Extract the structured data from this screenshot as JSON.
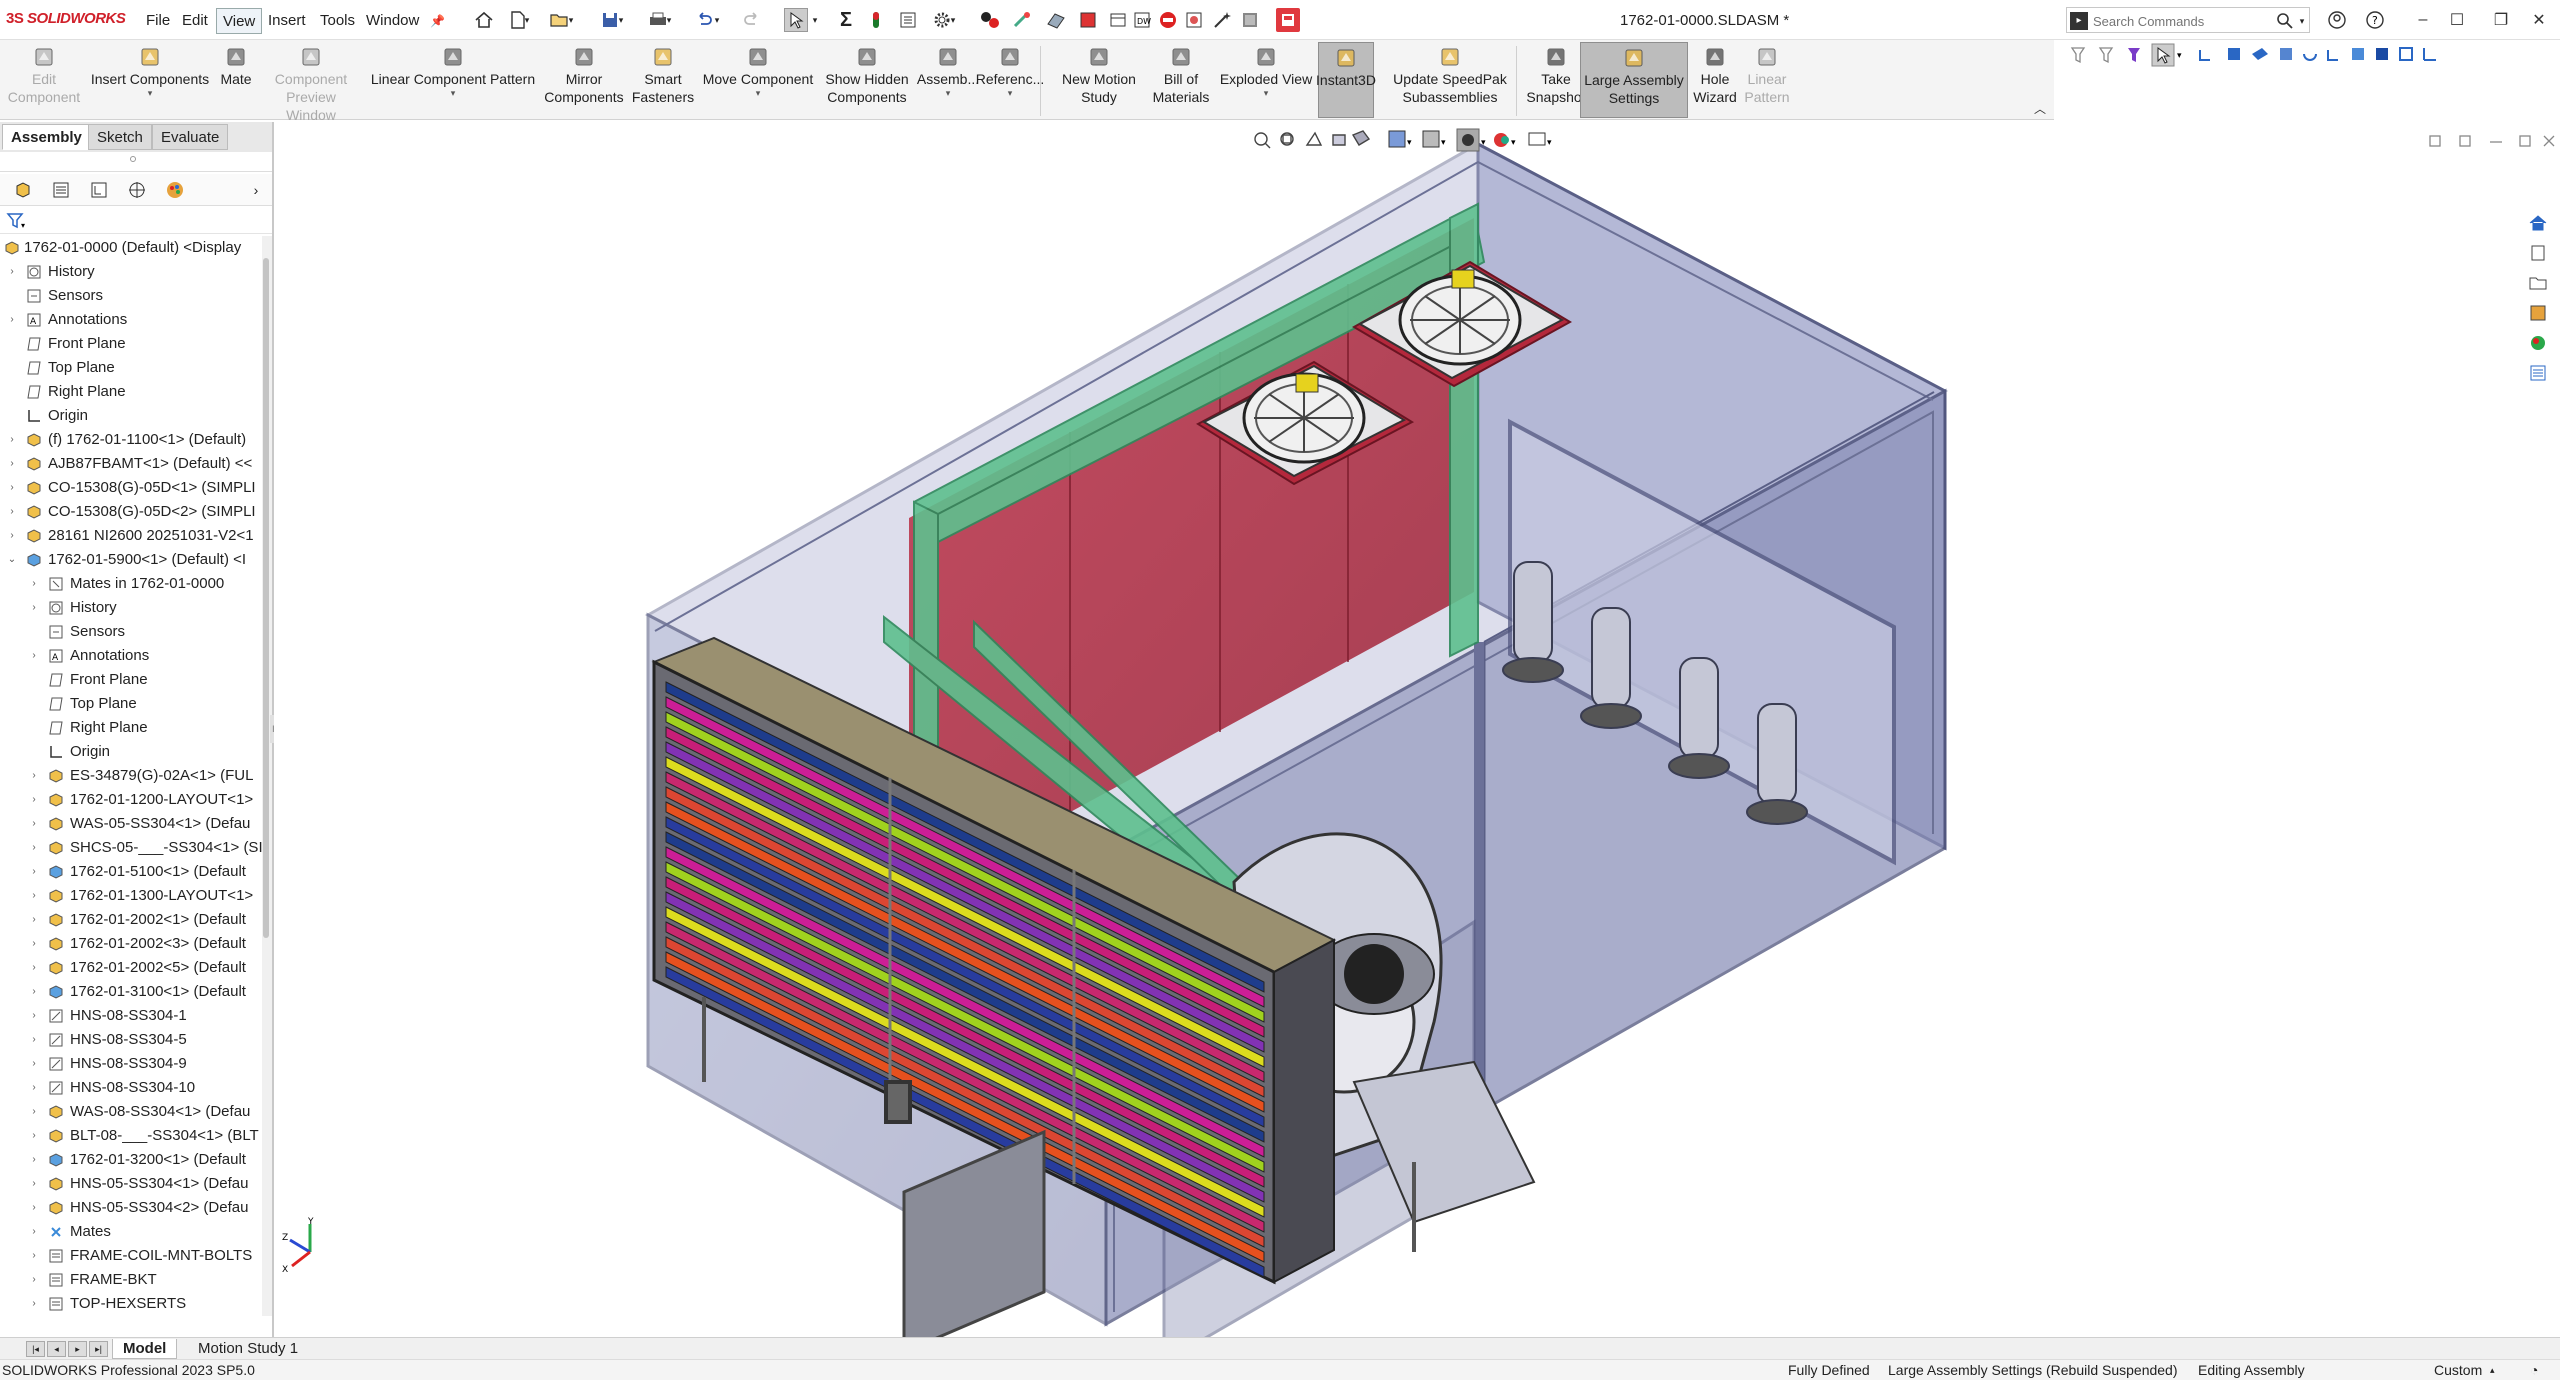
{
  "app": {
    "logo_text": "SOLIDWORKS",
    "logo_mark": "3S",
    "document_title": "1762-01-0000.SLDASM *",
    "accent": "#d0202a"
  },
  "menu": [
    {
      "label": "File"
    },
    {
      "label": "Edit"
    },
    {
      "label": "View",
      "active": true
    },
    {
      "label": "Insert"
    },
    {
      "label": "Tools"
    },
    {
      "label": "Window"
    }
  ],
  "search": {
    "placeholder": "Search Commands"
  },
  "command_manager": [
    {
      "line1": "Edit",
      "line2": "Component",
      "disabled": true,
      "icon": "edit-component-icon"
    },
    {
      "line1": "Insert Components",
      "line2": "",
      "icon": "insert-components-icon",
      "dropdown": true
    },
    {
      "line1": "Mate",
      "line2": "",
      "icon": "mate-icon"
    },
    {
      "line1": "Component",
      "line2": "Preview Window",
      "disabled": true,
      "icon": "component-preview-icon"
    },
    {
      "line1": "Linear Component Pattern",
      "line2": "",
      "icon": "linear-pattern-icon",
      "dropdown": true
    },
    {
      "line1": "Mirror",
      "line2": "Components",
      "icon": "mirror-components-icon"
    },
    {
      "line1": "Smart",
      "line2": "Fasteners",
      "icon": "smart-fasteners-icon"
    },
    {
      "line1": "Move Component",
      "line2": "",
      "icon": "move-component-icon",
      "dropdown": true
    },
    {
      "line1": "Show Hidden",
      "line2": "Components",
      "icon": "show-hidden-icon"
    },
    {
      "line1": "Assemb...",
      "line2": "",
      "icon": "assembly-features-icon",
      "dropdown": true
    },
    {
      "line1": "Referenc...",
      "line2": "",
      "icon": "reference-geometry-icon",
      "dropdown": true
    },
    {
      "line1": "New Motion",
      "line2": "Study",
      "icon": "motion-study-icon"
    },
    {
      "line1": "Bill of",
      "line2": "Materials",
      "icon": "bom-icon"
    },
    {
      "line1": "Exploded View",
      "line2": "",
      "icon": "exploded-view-icon",
      "dropdown": true
    },
    {
      "line1": "Instant3D",
      "line2": "",
      "icon": "instant3d-icon",
      "pressed": true
    },
    {
      "line1": "Update SpeedPak",
      "line2": "Subassemblies",
      "icon": "speedpak-icon"
    },
    {
      "line1": "Take",
      "line2": "Snapshot",
      "icon": "snapshot-icon"
    },
    {
      "line1": "Large Assembly",
      "line2": "Settings",
      "icon": "large-assembly-icon",
      "pressed": true
    },
    {
      "line1": "Hole",
      "line2": "Wizard",
      "icon": "hole-wizard-icon"
    },
    {
      "line1": "Linear",
      "line2": "Pattern",
      "disabled": true,
      "icon": "linear-pattern-feature-icon"
    }
  ],
  "panel_tabs": [
    {
      "label": "Assembly",
      "active": true
    },
    {
      "label": "Sketch"
    },
    {
      "label": "Evaluate"
    }
  ],
  "tree": [
    {
      "label": "1762-01-0000 (Default) <Display",
      "depth": 0,
      "icon": "assembly-icon",
      "exp": ""
    },
    {
      "label": "History",
      "depth": 1,
      "icon": "history-icon",
      "exp": "›"
    },
    {
      "label": "Sensors",
      "depth": 1,
      "icon": "sensors-icon",
      "exp": ""
    },
    {
      "label": "Annotations",
      "depth": 1,
      "icon": "annotations-icon",
      "exp": "›"
    },
    {
      "label": "Front Plane",
      "depth": 1,
      "icon": "plane-icon",
      "exp": ""
    },
    {
      "label": "Top Plane",
      "depth": 1,
      "icon": "plane-icon",
      "exp": ""
    },
    {
      "label": "Right Plane",
      "depth": 1,
      "icon": "plane-icon",
      "exp": ""
    },
    {
      "label": "Origin",
      "depth": 1,
      "icon": "origin-icon",
      "exp": ""
    },
    {
      "label": "(f) 1762-01-1100<1> (Default)",
      "depth": 1,
      "icon": "subassembly-icon",
      "exp": "›"
    },
    {
      "label": "AJB87FBAMT<1> (Default) <<",
      "depth": 1,
      "icon": "subassembly-icon",
      "exp": "›"
    },
    {
      "label": "CO-15308(G)-05D<1> (SIMPLI",
      "depth": 1,
      "icon": "subassembly-icon",
      "exp": "›"
    },
    {
      "label": "CO-15308(G)-05D<2> (SIMPLI",
      "depth": 1,
      "icon": "subassembly-icon",
      "exp": "›"
    },
    {
      "label": "28161 NI2600 20251031-V2<1",
      "depth": 1,
      "icon": "subassembly-icon",
      "exp": "›"
    },
    {
      "label": "1762-01-5900<1> (Default) <I",
      "depth": 1,
      "icon": "subassembly-edit-icon",
      "exp": "⌄"
    },
    {
      "label": "Mates in 1762-01-0000",
      "depth": 2,
      "icon": "mates-folder-icon",
      "exp": "›"
    },
    {
      "label": "History",
      "depth": 2,
      "icon": "history-icon",
      "exp": "›"
    },
    {
      "label": "Sensors",
      "depth": 2,
      "icon": "sensors-icon",
      "exp": ""
    },
    {
      "label": "Annotations",
      "depth": 2,
      "icon": "annotations-icon",
      "exp": "›"
    },
    {
      "label": "Front Plane",
      "depth": 2,
      "icon": "plane-icon",
      "exp": ""
    },
    {
      "label": "Top Plane",
      "depth": 2,
      "icon": "plane-icon",
      "exp": ""
    },
    {
      "label": "Right Plane",
      "depth": 2,
      "icon": "plane-icon",
      "exp": ""
    },
    {
      "label": "Origin",
      "depth": 2,
      "icon": "origin-icon",
      "exp": ""
    },
    {
      "label": "ES-34879(G)-02A<1> (FUL",
      "depth": 2,
      "icon": "subassembly-icon",
      "exp": "›"
    },
    {
      "label": "1762-01-1200-LAYOUT<1>",
      "depth": 2,
      "icon": "subassembly-icon",
      "exp": "›"
    },
    {
      "label": "WAS-05-SS304<1> (Defau",
      "depth": 2,
      "icon": "subassembly-icon",
      "exp": "›"
    },
    {
      "label": "SHCS-05-___-SS304<1> (SI",
      "depth": 2,
      "icon": "subassembly-icon",
      "exp": "›"
    },
    {
      "label": "1762-01-5100<1> (Default",
      "depth": 2,
      "icon": "subassembly-edit-icon",
      "exp": "›"
    },
    {
      "label": "1762-01-1300-LAYOUT<1>",
      "depth": 2,
      "icon": "subassembly-icon",
      "exp": "›"
    },
    {
      "label": "1762-01-2002<1> (Default",
      "depth": 2,
      "icon": "subassembly-icon",
      "exp": "›"
    },
    {
      "label": "1762-01-2002<3> (Default",
      "depth": 2,
      "icon": "subassembly-icon",
      "exp": "›"
    },
    {
      "label": "1762-01-2002<5> (Default",
      "depth": 2,
      "icon": "subassembly-icon",
      "exp": "›"
    },
    {
      "label": "1762-01-3100<1> (Default",
      "depth": 2,
      "icon": "subassembly-edit-icon",
      "exp": "›"
    },
    {
      "label": "HNS-08-SS304-1",
      "depth": 2,
      "icon": "pattern-icon",
      "exp": "›"
    },
    {
      "label": "HNS-08-SS304-5",
      "depth": 2,
      "icon": "pattern-icon",
      "exp": "›"
    },
    {
      "label": "HNS-08-SS304-9",
      "depth": 2,
      "icon": "pattern-icon",
      "exp": "›"
    },
    {
      "label": "HNS-08-SS304-10",
      "depth": 2,
      "icon": "pattern-icon",
      "exp": "›"
    },
    {
      "label": "WAS-08-SS304<1> (Defau",
      "depth": 2,
      "icon": "subassembly-icon",
      "exp": "›"
    },
    {
      "label": "BLT-08-___-SS304<1> (BLT",
      "depth": 2,
      "icon": "subassembly-icon",
      "exp": "›"
    },
    {
      "label": "1762-01-3200<1> (Default",
      "depth": 2,
      "icon": "subassembly-edit-icon",
      "exp": "›"
    },
    {
      "label": "HNS-05-SS304<1> (Defau",
      "depth": 2,
      "icon": "subassembly-icon",
      "exp": "›"
    },
    {
      "label": "HNS-05-SS304<2> (Defau",
      "depth": 2,
      "icon": "subassembly-icon",
      "exp": "›"
    },
    {
      "label": "Mates",
      "depth": 2,
      "icon": "mates-icon",
      "exp": "›"
    },
    {
      "label": "FRAME-COIL-MNT-BOLTS",
      "depth": 2,
      "icon": "folder-icon",
      "exp": "›"
    },
    {
      "label": "FRAME-BKT",
      "depth": 2,
      "icon": "folder-icon",
      "exp": "›"
    },
    {
      "label": "TOP-HEXSERTS",
      "depth": 2,
      "icon": "folder-icon",
      "exp": "›"
    }
  ],
  "bottom_tabs": [
    {
      "label": "Model",
      "active": true
    },
    {
      "label": "Motion Study 1"
    }
  ],
  "status": {
    "left": "SOLIDWORKS Professional 2023 SP5.0",
    "defined": "Fully Defined",
    "settings": "Large Assembly Settings (Rebuild Suspended)",
    "mode": "Editing Assembly",
    "units": "Custom"
  },
  "colors": {
    "housing": "#8a8fb8",
    "red_panel": "#b4283c",
    "green_frame": "#5ec08e",
    "coil_fins": [
      "#1e3c8c",
      "#cc1e96",
      "#a0d21e",
      "#c81e78",
      "#8232b4",
      "#dcdc1e",
      "#c8286e",
      "#dc4632",
      "#e6501e",
      "#283c9e"
    ]
  },
  "axis": {
    "x": "X",
    "y": "Y",
    "z": "Z"
  }
}
